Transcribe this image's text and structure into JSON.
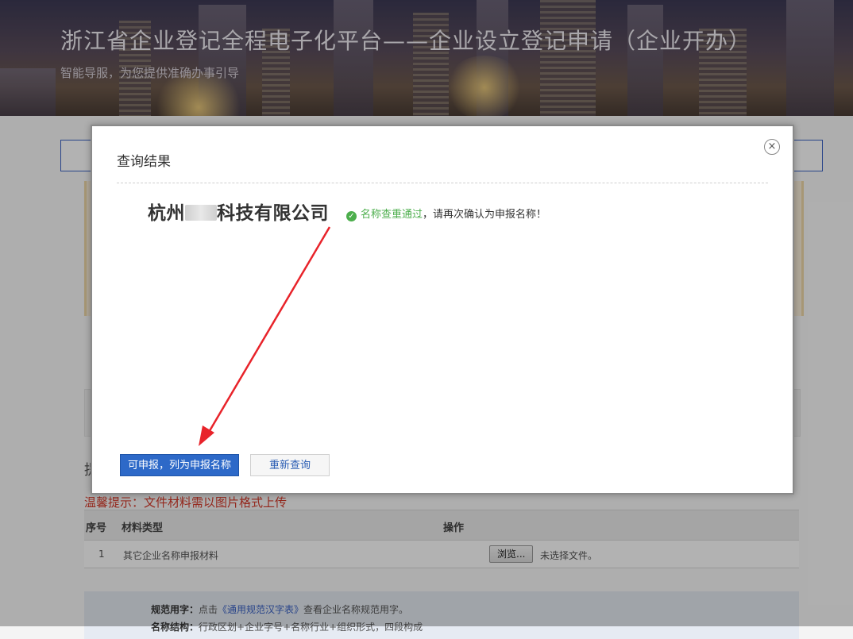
{
  "banner": {
    "title": "浙江省企业登记全程电子化平台——企业设立登记申请（企业开办）",
    "subtitle": "智能导服，为您提供准确办事引导"
  },
  "background": {
    "section_label": "提",
    "warm_tip": "温馨提示：文件材料需以图片格式上传",
    "table": {
      "headers": [
        "序号",
        "材料类型",
        "操作"
      ],
      "rows": [
        {
          "no": "1",
          "type": "其它企业名称申报材料",
          "browse": "浏览...",
          "file_status": "未选择文件。"
        }
      ]
    },
    "notes": {
      "line1_label": "规范用字：",
      "line1_pre": "点击",
      "line1_link": "《通用规范汉字表》",
      "line1_post": "查看企业名称规范用字。",
      "line2_label": "名称结构：",
      "line2_text": "行政区划+企业字号+名称行业+组织形式，四段构成"
    }
  },
  "modal": {
    "title": "查询结果",
    "close_symbol": "×",
    "company_prefix": "杭州",
    "company_suffix": "科技有限公司",
    "status_ok": "名称查重通过",
    "status_rest": "，请再次确认为申报名称！",
    "check_symbol": "✓",
    "primary_button": "可申报，列为申报名称",
    "secondary_button": "重新查询"
  },
  "colors": {
    "primary": "#2d69c8",
    "success": "#4cae4c",
    "warning_text": "#d43a2a",
    "annotation_arrow": "#e8232a"
  }
}
